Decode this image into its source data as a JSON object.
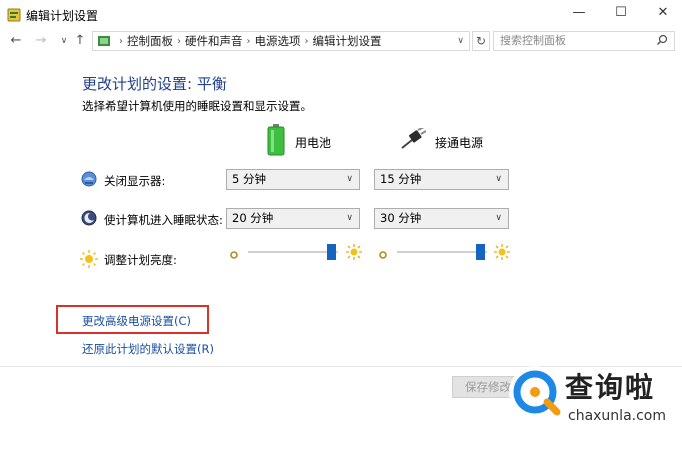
{
  "window": {
    "title": "编辑计划设置",
    "controls": [
      "—",
      "☐",
      "✕"
    ]
  },
  "nav": {
    "back": "←",
    "forward": "→",
    "dropdown": "∨",
    "up": "↑",
    "breadcrumbs": [
      "控制面板",
      "硬件和声音",
      "电源选项",
      "编辑计划设置"
    ],
    "separator": "›",
    "address_dropdown": "∨",
    "refresh": "↻",
    "search_placeholder": "搜索控制面板"
  },
  "main": {
    "heading": "更改计划的设置: 平衡",
    "subheading": "选择希望计算机使用的睡眠设置和显示设置。",
    "columns": {
      "battery": "用电池",
      "plugged": "接通电源"
    },
    "rows": [
      {
        "label": "关闭显示器:",
        "battery": "5 分钟",
        "plugged": "15 分钟"
      },
      {
        "label": "使计算机进入睡眠状态:",
        "battery": "20 分钟",
        "plugged": "30 分钟"
      }
    ],
    "brightness": {
      "label": "调整计划亮度:",
      "battery_level": 0.97,
      "plugged_level": 0.97
    },
    "links": {
      "advanced": "更改高级电源设置(C)",
      "restore": "还原此计划的默认设置(R)"
    },
    "save_button": "保存修改"
  },
  "watermark": {
    "brand": "查询啦",
    "url": "chaxunla.com"
  },
  "colors": {
    "heading": "#1f3f8f",
    "link": "#1a4fa0",
    "highlight_box": "#d9312b",
    "slider_thumb": "#1565c0"
  }
}
